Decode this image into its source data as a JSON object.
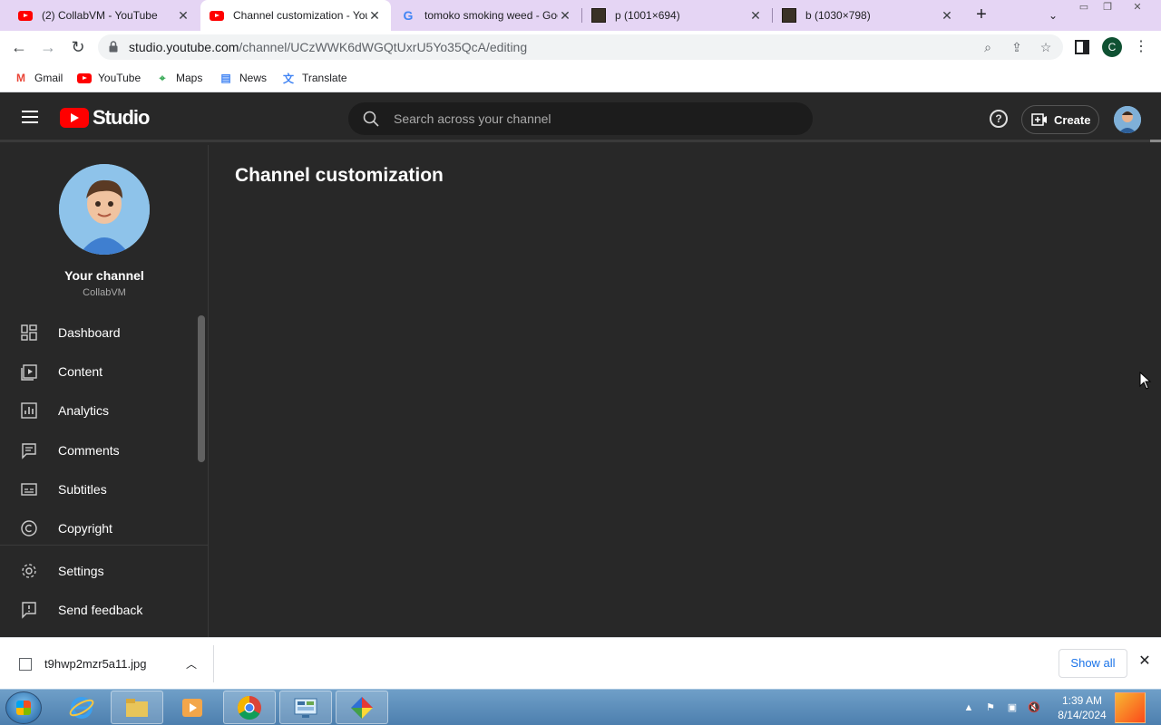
{
  "browser": {
    "tabs": [
      {
        "title": "(2) CollabVM - YouTube",
        "icon": "youtube-icon",
        "active": false
      },
      {
        "title": "Channel customization - YouTube Studio",
        "icon": "youtube-icon",
        "active": true
      },
      {
        "title": "tomoko smoking weed - Google Search",
        "icon": "google-icon",
        "active": false
      },
      {
        "title": "p (1001×694)",
        "icon": "image-icon",
        "active": false
      },
      {
        "title": "b (1030×798)",
        "icon": "image-icon",
        "active": false
      }
    ],
    "new_tab": "+",
    "url_host": "studio.youtube.com",
    "url_path": "/channel/UCzWWK6dWGQtUxrU5Yo35QcA/editing",
    "profile_letter": "C",
    "bookmarks": [
      "Gmail",
      "YouTube",
      "Maps",
      "News",
      "Translate"
    ]
  },
  "studio": {
    "logo_text": "Studio",
    "search_placeholder": "Search across your channel",
    "help": "?",
    "create_label": "Create",
    "channel_name": "Your channel",
    "channel_handle": "CollabVM",
    "nav": [
      {
        "label": "Dashboard",
        "icon": "dashboard-icon"
      },
      {
        "label": "Content",
        "icon": "content-icon"
      },
      {
        "label": "Analytics",
        "icon": "analytics-icon"
      },
      {
        "label": "Comments",
        "icon": "comments-icon"
      },
      {
        "label": "Subtitles",
        "icon": "subtitles-icon"
      },
      {
        "label": "Copyright",
        "icon": "copyright-icon"
      },
      {
        "label": "Settings",
        "icon": "settings-icon"
      },
      {
        "label": "Send feedback",
        "icon": "feedback-icon"
      }
    ],
    "page_title": "Channel customization"
  },
  "downloads": {
    "filename": "t9hwp2mzr5a11.jpg",
    "show_all": "Show all"
  },
  "taskbar": {
    "time": "1:39 AM",
    "date": "8/14/2024"
  },
  "colors": {
    "studio_bg": "#282828",
    "youtube_red": "#ff0000",
    "tabstrip": "#e5d5f4",
    "link_blue": "#1a73e8"
  }
}
